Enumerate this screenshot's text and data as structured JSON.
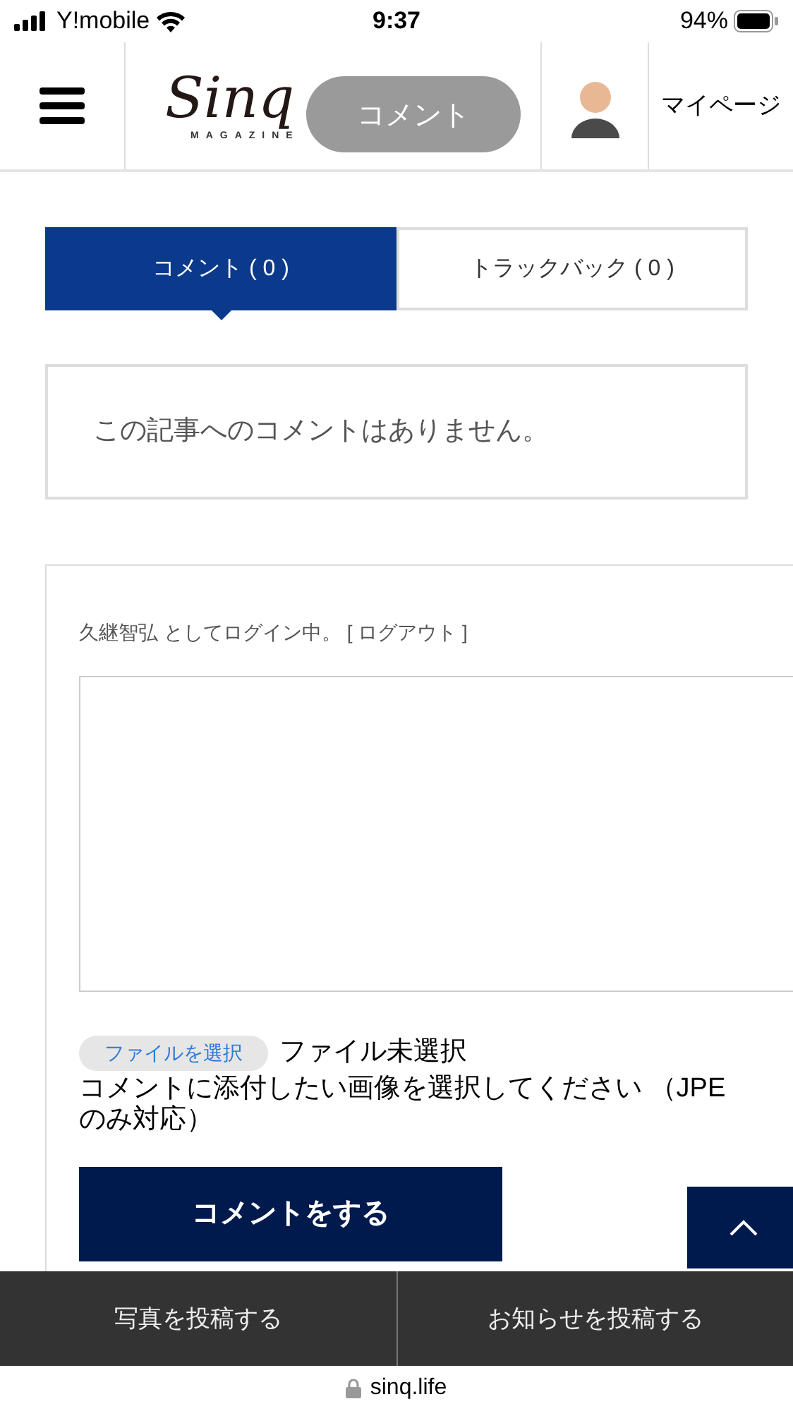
{
  "status_bar": {
    "carrier": "Y!mobile",
    "time": "9:37",
    "battery": "94%"
  },
  "header": {
    "logo": "Sinq",
    "logo_sub": "MAGAZINE",
    "floating_button": "コメント",
    "mypage": "マイページ"
  },
  "tabs": [
    {
      "label": "コメント ( 0 )",
      "selected": true
    },
    {
      "label": "トラックバック ( 0 )",
      "selected": false
    }
  ],
  "empty_notice": "この記事へのコメントはありません。",
  "form": {
    "login_status": "久継智弘 としてログイン中。",
    "logout_link": "[ ログアウト ]",
    "file_button": "ファイルを選択",
    "file_status": "ファイル未選択",
    "file_hint_lines": [
      "コメントに添付したい画像を選択してください （JPE",
      "のみ対応）"
    ],
    "submit": "コメントをする"
  },
  "bottom_bar": [
    "写真を投稿する",
    "お知らせを投稿する"
  ],
  "url_bar": {
    "domain": "sinq.life"
  }
}
